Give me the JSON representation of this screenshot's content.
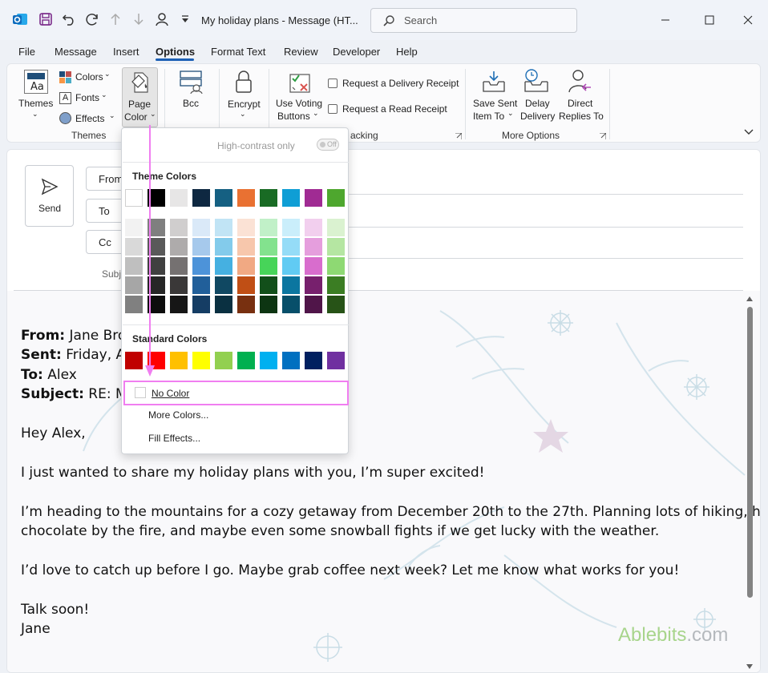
{
  "window": {
    "title": "My holiday plans  -  Message (HT...",
    "search_placeholder": "Search"
  },
  "menu": {
    "tabs": [
      "File",
      "Message",
      "Insert",
      "Options",
      "Format Text",
      "Review",
      "Developer",
      "Help"
    ],
    "active_tab": "Options"
  },
  "ribbon": {
    "themes_label": "Themes",
    "colors_label": "Colors",
    "fonts_label": "Fonts",
    "effects_label": "Effects",
    "page_color_line1": "Page",
    "page_color_line2": "Color",
    "themes_group": "Themes",
    "bcc_label": "Bcc",
    "encrypt_label": "Encrypt",
    "voting_line1": "Use Voting",
    "voting_line2": "Buttons",
    "delivery_receipt": "Request a Delivery Receipt",
    "read_receipt": "Request a Read Receipt",
    "tracking_group": "acking",
    "save_sent_line1": "Save Sent",
    "save_sent_line2": "Item To",
    "delay_line1": "Delay",
    "delay_line2": "Delivery",
    "direct_line1": "Direct",
    "direct_line2": "Replies To",
    "more_options_group": "More Options"
  },
  "compose": {
    "send_label": "Send",
    "from_btn": "From",
    "to_btn": "To",
    "cc_btn": "Cc",
    "subject_label": "Subj"
  },
  "color_menu": {
    "high_contrast": "High-contrast only",
    "toggle_state": "Off",
    "theme_colors_heading": "Theme Colors",
    "standard_colors_heading": "Standard Colors",
    "no_color": "No Color",
    "more_colors": "More Colors...",
    "fill_effects": "Fill Effects...",
    "theme_top_row": [
      "#ffffff",
      "#000000",
      "#e7e6e6",
      "#0e2841",
      "#156082",
      "#e97132",
      "#196b24",
      "#0f9ed5",
      "#a02b93",
      "#4ea72e"
    ],
    "theme_shades": [
      [
        "#f2f2f2",
        "#7f7f7f",
        "#d0cece",
        "#dae9f8",
        "#c1e4f5",
        "#fbe2d5",
        "#c1f0c8",
        "#caeefb",
        "#f2cfee",
        "#daf2d0"
      ],
      [
        "#d9d9d9",
        "#595959",
        "#aeabab",
        "#a6c9ec",
        "#83cbeb",
        "#f7c7ac",
        "#83e28e",
        "#95dcf7",
        "#e59edd",
        "#b5e6a2"
      ],
      [
        "#bfbfbf",
        "#404040",
        "#757171",
        "#4d93d9",
        "#45b0e1",
        "#f1a983",
        "#47d459",
        "#61cbf3",
        "#d86dcd",
        "#8ed973"
      ],
      [
        "#a6a6a6",
        "#262626",
        "#3a3838",
        "#215f9a",
        "#104862",
        "#c04f15",
        "#124f1a",
        "#0b76a0",
        "#77206d",
        "#3b7d23"
      ],
      [
        "#808080",
        "#0d0d0d",
        "#161616",
        "#153d64",
        "#0a3041",
        "#783010",
        "#0d3512",
        "#074f6a",
        "#501549",
        "#275317"
      ]
    ],
    "standard": [
      "#c00000",
      "#ff0000",
      "#ffc000",
      "#ffff00",
      "#92d050",
      "#00b050",
      "#00b0f0",
      "#0070c0",
      "#002060",
      "#7030a0"
    ],
    "accent": "#f07ef0"
  },
  "message": {
    "from_key": "From:",
    "from_val": " Jane Brow",
    "sent_key": "Sent:",
    "sent_val": " Friday, Aug",
    "to_key": "To:",
    "to_val": " Alex",
    "subject_key": "Subject:",
    "subject_val": " RE: My",
    "greeting": "Hey Alex,",
    "p1": "I just wanted to share my holiday plans with you, I’m super excited!",
    "p2_line1": "I’m heading to the mountains for a cozy getaway from December 20th to the 27th. Planning lots of hiking, hot",
    "p2_line2": "chocolate by the fire, and maybe even some snowball fights if we get lucky with the weather.",
    "p3": "I’d love to catch up before I go. Maybe grab coffee next week? Let me know what works for you!",
    "closing": "Talk soon!",
    "signature": "Jane"
  },
  "watermark": {
    "brand": "Ablebits",
    "suffix": ".com"
  }
}
